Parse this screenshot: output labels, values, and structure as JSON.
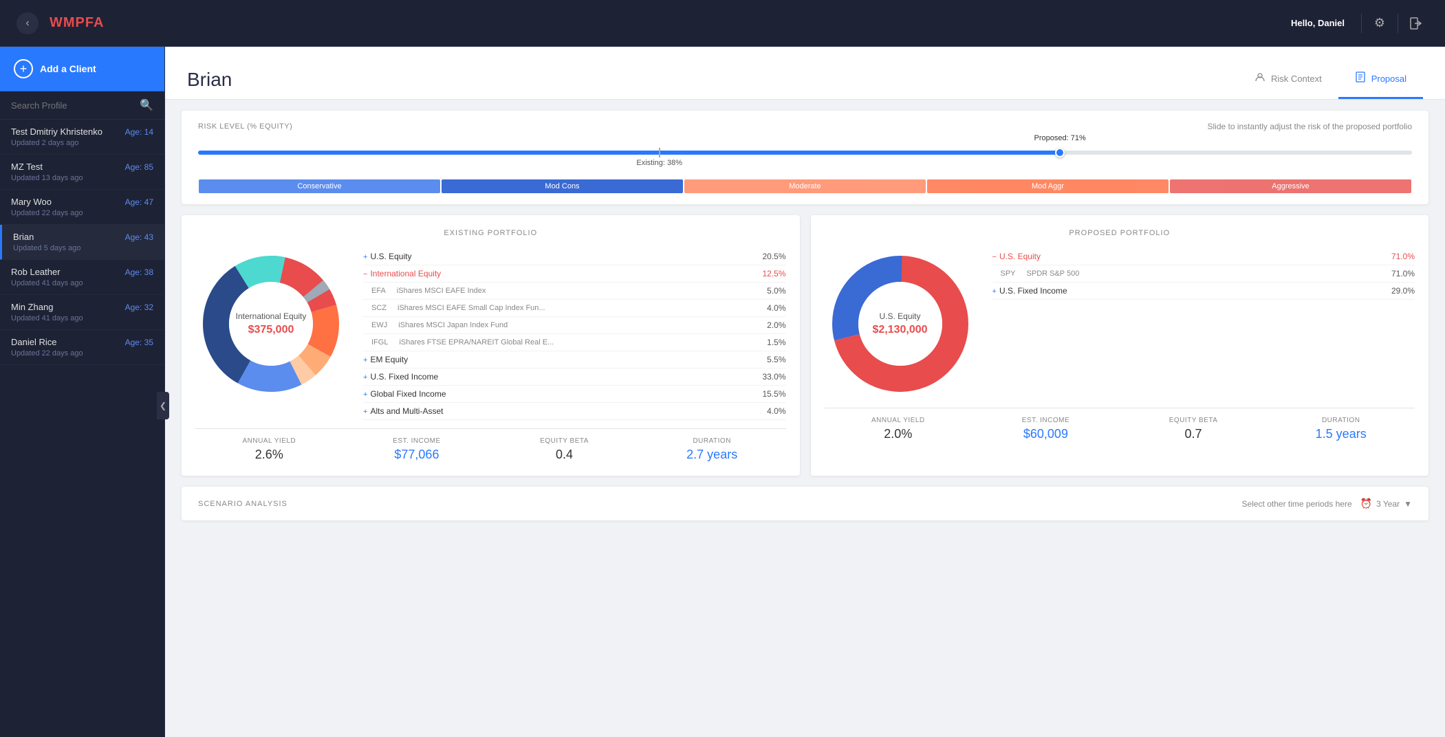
{
  "app": {
    "brand": "WMPFA",
    "greeting": "Hello,",
    "user": "Daniel"
  },
  "nav": {
    "back_title": "back",
    "settings_icon": "⚙",
    "logout_icon": "⬚"
  },
  "sidebar": {
    "add_client_label": "Add a Client",
    "search_placeholder": "Search Profile",
    "clients": [
      {
        "name": "Test Dmitriy Khristenko",
        "age": "Age: 14",
        "updated": "Updated 2 days ago",
        "active": false
      },
      {
        "name": "MZ Test",
        "age": "Age: 85",
        "updated": "Updated 13 days ago",
        "active": false
      },
      {
        "name": "Mary Woo",
        "age": "Age: 47",
        "updated": "Updated 22 days ago",
        "active": false
      },
      {
        "name": "Brian",
        "age": "Age: 43",
        "updated": "Updated 5 days ago",
        "active": true
      },
      {
        "name": "Rob Leather",
        "age": "Age: 38",
        "updated": "Updated 41 days ago",
        "active": false
      },
      {
        "name": "Min Zhang",
        "age": "Age: 32",
        "updated": "Updated 41 days ago",
        "active": false
      },
      {
        "name": "Daniel Rice",
        "age": "Age: 35",
        "updated": "Updated 22 days ago",
        "active": false
      }
    ]
  },
  "page": {
    "title": "Brian",
    "tabs": [
      {
        "label": "Risk Context",
        "icon": "👤",
        "active": false
      },
      {
        "label": "Proposal",
        "icon": "📋",
        "active": true
      }
    ]
  },
  "risk": {
    "label": "RISK LEVEL (% EQUITY)",
    "description": "Slide to instantly adjust the risk of the proposed portfolio",
    "proposed_label": "Proposed: 71%",
    "existing_label": "Existing: 38%",
    "proposed_pct": 71,
    "existing_pct": 38,
    "categories": [
      {
        "label": "Conservative",
        "class": "conservative"
      },
      {
        "label": "Mod Cons",
        "class": "mod-cons"
      },
      {
        "label": "Moderate",
        "class": "moderate"
      },
      {
        "label": "Mod Aggr",
        "class": "mod-aggr"
      },
      {
        "label": "Aggressive",
        "class": "aggressive"
      }
    ]
  },
  "existing_portfolio": {
    "title": "EXISTING PORTFOLIO",
    "donut_center_title": "International Equity",
    "donut_center_value": "$375,000",
    "holdings": [
      {
        "plus": true,
        "name": "U.S. Equity",
        "ticker": "",
        "fund": "",
        "pct": "20.5%",
        "red": false,
        "indent": false
      },
      {
        "plus": false,
        "minus": true,
        "name": "International Equity",
        "ticker": "",
        "fund": "",
        "pct": "12.5%",
        "red": true,
        "indent": false
      },
      {
        "plus": false,
        "name": "",
        "ticker": "EFA",
        "fund": "iShares MSCI EAFE Index",
        "pct": "5.0%",
        "red": false,
        "indent": true
      },
      {
        "plus": false,
        "name": "",
        "ticker": "SCZ",
        "fund": "iShares MSCI EAFE Small Cap Index Fun...",
        "pct": "4.0%",
        "red": false,
        "indent": true
      },
      {
        "plus": false,
        "name": "",
        "ticker": "EWJ",
        "fund": "iShares MSCI Japan Index Fund",
        "pct": "2.0%",
        "red": false,
        "indent": true
      },
      {
        "plus": false,
        "name": "",
        "ticker": "IFGL",
        "fund": "iShares FTSE EPRA/NAREIT Global Real E...",
        "pct": "1.5%",
        "red": false,
        "indent": true
      },
      {
        "plus": true,
        "name": "EM Equity",
        "ticker": "",
        "fund": "",
        "pct": "5.5%",
        "red": false,
        "indent": false
      },
      {
        "plus": true,
        "name": "U.S. Fixed Income",
        "ticker": "",
        "fund": "",
        "pct": "33.0%",
        "red": false,
        "indent": false
      },
      {
        "plus": true,
        "name": "Global Fixed Income",
        "ticker": "",
        "fund": "",
        "pct": "15.5%",
        "red": false,
        "indent": false
      },
      {
        "plus": true,
        "name": "Alts and Multi-Asset",
        "ticker": "",
        "fund": "",
        "pct": "4.0%",
        "red": false,
        "indent": false
      }
    ],
    "stats": [
      {
        "label": "ANNUAL YIELD",
        "value": "2.6%",
        "blue": false
      },
      {
        "label": "EST. INCOME",
        "value": "$77,066",
        "blue": true
      },
      {
        "label": "EQUITY BETA",
        "value": "0.4",
        "blue": false
      },
      {
        "label": "DURATION",
        "value": "2.7 years",
        "blue": true
      }
    ]
  },
  "proposed_portfolio": {
    "title": "PROPOSED PORTFOLIO",
    "donut_center_title": "U.S. Equity",
    "donut_center_value": "$2,130,000",
    "holdings": [
      {
        "minus": true,
        "name": "U.S. Equity",
        "ticker": "",
        "fund": "",
        "pct": "71.0%",
        "red": true
      },
      {
        "minus": false,
        "name": "SPY",
        "ticker": "SPY",
        "fund": "SPDR S&P 500",
        "pct": "71.0%",
        "red": false,
        "indent": true
      },
      {
        "minus": false,
        "plus": true,
        "name": "U.S. Fixed Income",
        "ticker": "",
        "fund": "",
        "pct": "29.0%",
        "red": false
      }
    ],
    "stats": [
      {
        "label": "ANNUAL YIELD",
        "value": "2.0%",
        "blue": false
      },
      {
        "label": "EST. INCOME",
        "value": "$60,009",
        "blue": true
      },
      {
        "label": "EQUITY BETA",
        "value": "0.7",
        "blue": false
      },
      {
        "label": "DURATION",
        "value": "1.5 years",
        "blue": true
      }
    ]
  },
  "scenario": {
    "title": "SCENARIO ANALYSIS",
    "time_period_hint": "Select other time periods here",
    "time_period_value": "3 Year"
  }
}
